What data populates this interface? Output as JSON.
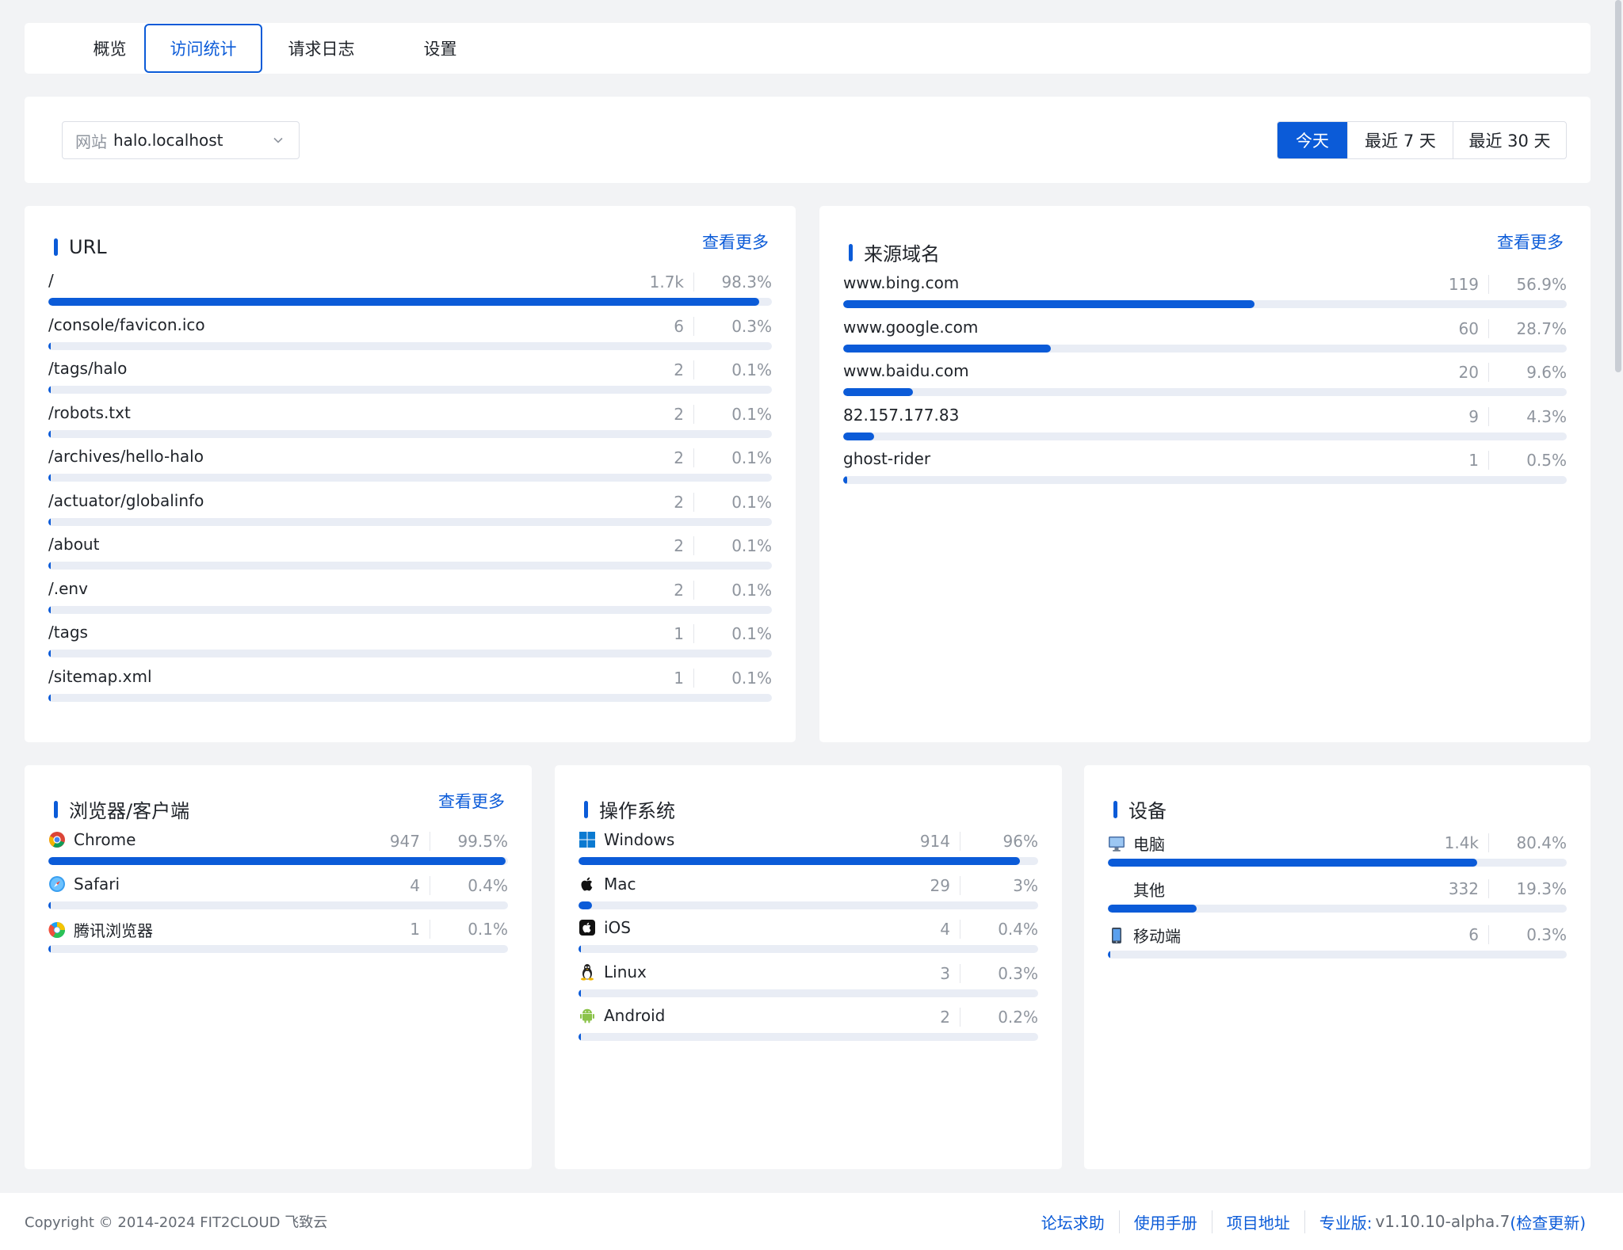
{
  "tabs": [
    {
      "label": "概览"
    },
    {
      "label": "访问统计"
    },
    {
      "label": "请求日志"
    },
    {
      "label": "设置"
    }
  ],
  "active_tab": 1,
  "filter": {
    "site_prefix": "网站",
    "site_value": "halo.localhost",
    "ranges": [
      {
        "label": "今天"
      },
      {
        "label": "最近 7 天"
      },
      {
        "label": "最近 30 天"
      }
    ],
    "active_range": 0
  },
  "url_card": {
    "title": "URL",
    "more": "查看更多",
    "rows": [
      {
        "label": "/",
        "count": "1.7k",
        "pct": "98.3%",
        "ratio": 0.983
      },
      {
        "label": "/console/favicon.ico",
        "count": "6",
        "pct": "0.3%",
        "ratio": 0.003
      },
      {
        "label": "/tags/halo",
        "count": "2",
        "pct": "0.1%",
        "ratio": 0.001
      },
      {
        "label": "/robots.txt",
        "count": "2",
        "pct": "0.1%",
        "ratio": 0.001
      },
      {
        "label": "/archives/hello-halo",
        "count": "2",
        "pct": "0.1%",
        "ratio": 0.001
      },
      {
        "label": "/actuator/globalinfo",
        "count": "2",
        "pct": "0.1%",
        "ratio": 0.001
      },
      {
        "label": "/about",
        "count": "2",
        "pct": "0.1%",
        "ratio": 0.001
      },
      {
        "label": "/.env",
        "count": "2",
        "pct": "0.1%",
        "ratio": 0.001
      },
      {
        "label": "/tags",
        "count": "1",
        "pct": "0.1%",
        "ratio": 0.001
      },
      {
        "label": "/sitemap.xml",
        "count": "1",
        "pct": "0.1%",
        "ratio": 0.001
      }
    ]
  },
  "referer_card": {
    "title": "来源域名",
    "more": "查看更多",
    "rows": [
      {
        "label": "www.bing.com",
        "count": "119",
        "pct": "56.9%",
        "ratio": 0.569
      },
      {
        "label": "www.google.com",
        "count": "60",
        "pct": "28.7%",
        "ratio": 0.287
      },
      {
        "label": "www.baidu.com",
        "count": "20",
        "pct": "9.6%",
        "ratio": 0.096
      },
      {
        "label": "82.157.177.83",
        "count": "9",
        "pct": "4.3%",
        "ratio": 0.043
      },
      {
        "label": "ghost-rider",
        "count": "1",
        "pct": "0.5%",
        "ratio": 0.005
      }
    ]
  },
  "browser_card": {
    "title": "浏览器/客户端",
    "more": "查看更多",
    "rows": [
      {
        "label": "Chrome",
        "count": "947",
        "pct": "99.5%",
        "ratio": 0.995,
        "icon": "chrome-icon"
      },
      {
        "label": "Safari",
        "count": "4",
        "pct": "0.4%",
        "ratio": 0.004,
        "icon": "safari-icon"
      },
      {
        "label": "腾讯浏览器",
        "count": "1",
        "pct": "0.1%",
        "ratio": 0.001,
        "icon": "tencent-browser-icon"
      }
    ]
  },
  "os_card": {
    "title": "操作系统",
    "rows": [
      {
        "label": "Windows",
        "count": "914",
        "pct": "96%",
        "ratio": 0.96,
        "icon": "windows-icon"
      },
      {
        "label": "Mac",
        "count": "29",
        "pct": "3%",
        "ratio": 0.03,
        "icon": "apple-icon"
      },
      {
        "label": "iOS",
        "count": "4",
        "pct": "0.4%",
        "ratio": 0.004,
        "icon": "ios-icon"
      },
      {
        "label": "Linux",
        "count": "3",
        "pct": "0.3%",
        "ratio": 0.003,
        "icon": "linux-icon"
      },
      {
        "label": "Android",
        "count": "2",
        "pct": "0.2%",
        "ratio": 0.002,
        "icon": "android-icon"
      }
    ]
  },
  "device_card": {
    "title": "设备",
    "rows": [
      {
        "label": "电脑",
        "count": "1.4k",
        "pct": "80.4%",
        "ratio": 0.804,
        "icon": "desktop-icon"
      },
      {
        "label": "其他",
        "count": "332",
        "pct": "19.3%",
        "ratio": 0.193,
        "icon": ""
      },
      {
        "label": "移动端",
        "count": "6",
        "pct": "0.3%",
        "ratio": 0.003,
        "icon": "mobile-icon"
      }
    ]
  },
  "footer": {
    "copyright": "Copyright © 2014-2024 FIT2CLOUD 飞致云",
    "links": [
      {
        "label": "论坛求助"
      },
      {
        "label": "使用手册"
      },
      {
        "label": "项目地址"
      }
    ],
    "version_label": "专业版:",
    "version": "v1.10.10-alpha.7",
    "check_update": "(检查更新)"
  },
  "colors": {
    "accent": "#0b5bd8",
    "track": "#e9edf5"
  }
}
